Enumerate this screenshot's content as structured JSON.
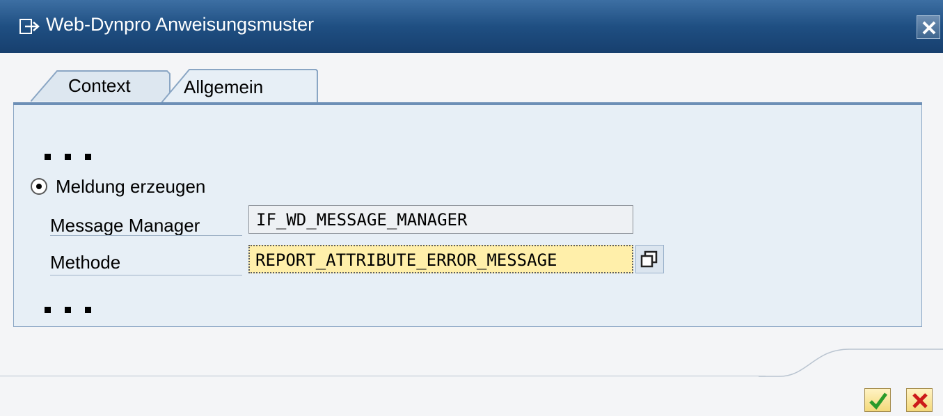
{
  "window": {
    "title": "Web-Dynpro Anweisungsmuster"
  },
  "tabs": [
    {
      "label": "Context",
      "active": false
    },
    {
      "label": "Allgemein",
      "active": true
    }
  ],
  "form": {
    "radio_label": "Meldung erzeugen",
    "radio_selected": true,
    "fields": [
      {
        "label": "Message Manager",
        "value": "IF_WD_MESSAGE_MANAGER",
        "editable": false
      },
      {
        "label": "Methode",
        "value": "REPORT_ATTRIBUTE_ERROR_MESSAGE",
        "editable": true
      }
    ]
  },
  "icons": {
    "title": "window-pointer-icon",
    "close": "close-icon",
    "value_help": "value-help-icon",
    "confirm": "checkmark-icon",
    "cancel": "cancel-x-icon"
  },
  "colors": {
    "titlebar": "#1f4f82",
    "panel": "#e7eff6",
    "active_input": "#ffefaa",
    "confirm_check": "#2a9a2a",
    "cancel_x": "#cc1a1a"
  }
}
